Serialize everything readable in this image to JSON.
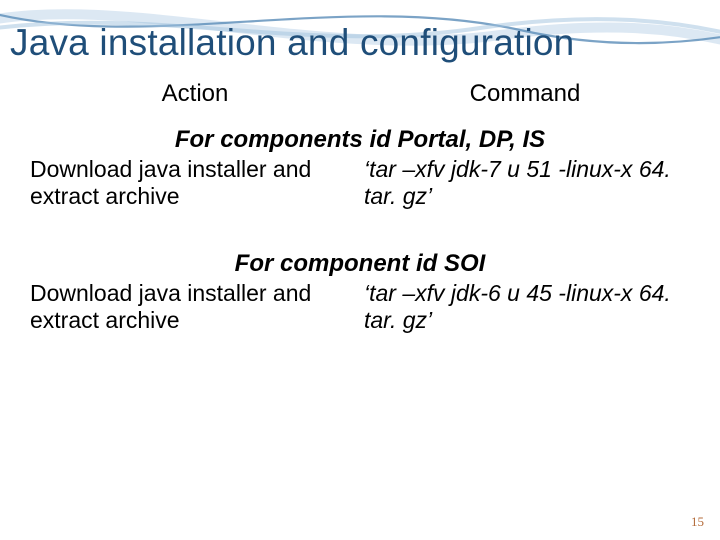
{
  "title": "Java installation and configuration",
  "headers": {
    "action": "Action",
    "command": "Command"
  },
  "sections": [
    {
      "title": "For components id Portal, DP, IS",
      "action": "Download java installer and extract archive",
      "command": "‘tar –xfv jdk-7 u 51 -linux-x 64. tar. gz’"
    },
    {
      "title": "For component id SOI",
      "action": "Download java installer and extract archive",
      "command": "‘tar –xfv jdk-6 u 45 -linux-x 64. tar. gz’"
    }
  ],
  "page_number": "15"
}
